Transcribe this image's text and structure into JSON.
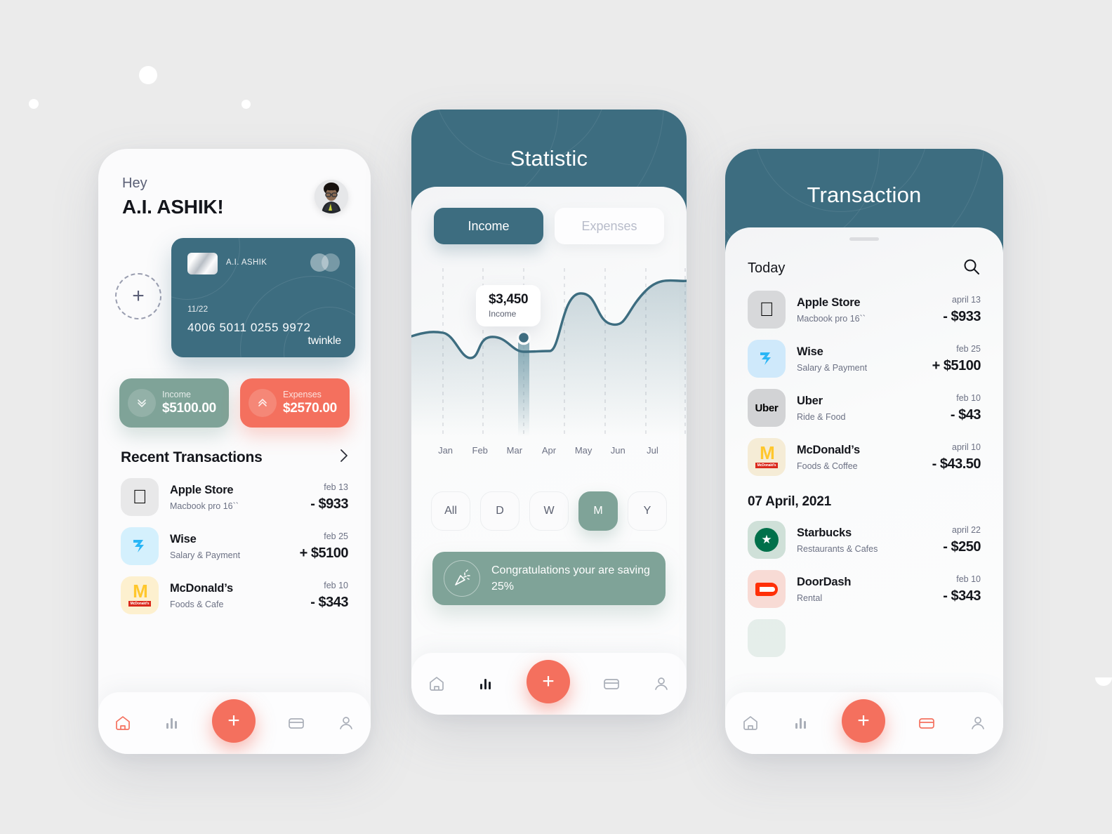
{
  "background": {
    "accent_coral": "#f4705e",
    "accent_teal": "#3d6d80",
    "accent_green": "#7fa398",
    "page_bg": "#ebebeb"
  },
  "home": {
    "greeting_hello": "Hey",
    "greeting_name": "A.I. ASHIK!",
    "add_card_glyph": "+",
    "card": {
      "holder": "A.I. ASHIK",
      "expiry": "11/22",
      "number": "4006 5011 0255 9972",
      "brand": "twinkle"
    },
    "income": {
      "label": "Income",
      "amount": "$5100.00"
    },
    "expenses": {
      "label": "Expenses",
      "amount": "$2570.00"
    },
    "recent_title": "Recent Transactions",
    "transactions": [
      {
        "name": "Apple Store",
        "sub": "Macbook  pro 16``",
        "date": "feb 13",
        "amount": "- $933",
        "logo": "apple"
      },
      {
        "name": "Wise",
        "sub": "Salary & Payment",
        "date": "feb 25",
        "amount": "+ $5100",
        "logo": "wise"
      },
      {
        "name": "McDonald’s",
        "sub": "Foods & Cafe",
        "date": "feb 10",
        "amount": "- $343",
        "logo": "mcdonalds"
      }
    ],
    "nav": {
      "fab": "+",
      "active": "home"
    }
  },
  "statistic": {
    "title": "Statistic",
    "tabs": [
      {
        "label": "Income",
        "active": true
      },
      {
        "label": "Expenses",
        "active": false
      }
    ],
    "tooltip": {
      "value": "$3,450",
      "label": "Income"
    },
    "ranges": [
      {
        "label": "All",
        "active": false
      },
      {
        "label": "D",
        "active": false
      },
      {
        "label": "W",
        "active": false
      },
      {
        "label": "M",
        "active": true
      },
      {
        "label": "Y",
        "active": false
      }
    ],
    "congrats": "Congratulations your are saving  25%",
    "nav": {
      "fab": "+",
      "active": "stats"
    }
  },
  "transaction": {
    "title": "Transaction",
    "today_label": "Today",
    "date_group": "07 April, 2021",
    "today_items": [
      {
        "name": "Apple Store",
        "sub": "Macbook  pro 16``",
        "date": "april 13",
        "amount": "- $933",
        "logo": "apple"
      },
      {
        "name": "Wise",
        "sub": "Salary & Payment",
        "date": "feb 25",
        "amount": "+ $5100",
        "logo": "wise"
      },
      {
        "name": "Uber",
        "sub": "Ride & Food",
        "date": "feb 10",
        "amount": "- $43",
        "logo": "uber"
      },
      {
        "name": "McDonald’s",
        "sub": "Foods & Coffee",
        "date": "april 10",
        "amount": "- $43.50",
        "logo": "mcdonalds"
      }
    ],
    "dated_items": [
      {
        "name": "Starbucks",
        "sub": "Restaurants & Cafes",
        "date": "april 22",
        "amount": "- $250",
        "logo": "starbucks"
      },
      {
        "name": "DoorDash",
        "sub": "Rental",
        "date": "feb 10",
        "amount": "- $343",
        "logo": "doordash"
      }
    ],
    "nav": {
      "fab": "+",
      "active": "card"
    }
  },
  "chart_data": {
    "type": "area",
    "title": "Income",
    "categories": [
      "Jan",
      "Feb",
      "Mar",
      "Apr",
      "May",
      "Jun",
      "Jul"
    ],
    "values": [
      3100,
      2500,
      3450,
      2700,
      4200,
      3600,
      4600
    ],
    "ylabel": "Income",
    "xlabel": "",
    "highlight": {
      "category": "Mar",
      "value": 3450,
      "label": "$3,450"
    },
    "grid": "vertical-dashed",
    "legend": "none",
    "line_color": "#3d6d80",
    "fill_color": "rgba(61,109,128,0.16)"
  }
}
